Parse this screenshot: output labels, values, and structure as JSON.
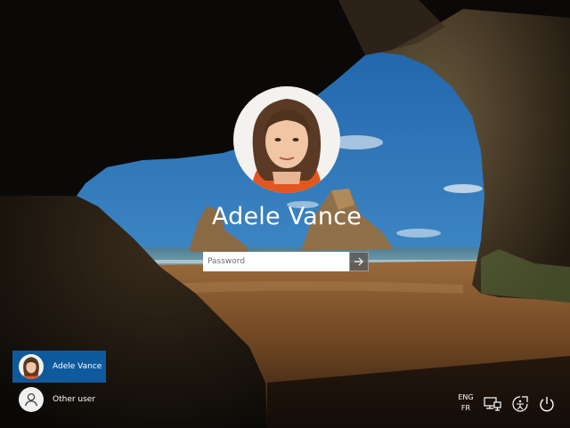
{
  "lock_screen": {
    "user_name": "Adele Vance",
    "password_placeholder": "Password",
    "password_value": ""
  },
  "user_list": [
    {
      "name": "Adele Vance",
      "selected": true,
      "avatar_icon": "user-photo"
    },
    {
      "name": "Other user",
      "selected": false,
      "avatar_icon": "person-icon"
    }
  ],
  "system_tray": {
    "language_line1": "ENG",
    "language_line2": "FR",
    "icons": [
      "network-icon",
      "ease-of-access-icon",
      "power-icon"
    ]
  },
  "colors": {
    "selected_user_bg": "#0e5a9d",
    "text": "#ffffff"
  }
}
